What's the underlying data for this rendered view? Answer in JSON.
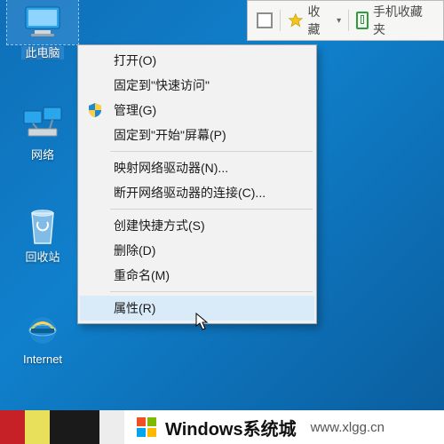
{
  "desktop_icons": {
    "this_pc": "此电脑",
    "network": "网络",
    "recycle": "回收站",
    "ie": "Internet"
  },
  "toolbar": {
    "favorites_label": "收藏",
    "mobile_fav_label": "手机收藏夹"
  },
  "ctx": {
    "open": "打开(O)",
    "pin_quick": "固定到\"快速访问\"",
    "manage": "管理(G)",
    "pin_start": "固定到\"开始\"屏幕(P)",
    "map_drive": "映射网络驱动器(N)...",
    "disconnect_drive": "断开网络驱动器的连接(C)...",
    "create_shortcut": "创建快捷方式(S)",
    "delete": "删除(D)",
    "rename": "重命名(M)",
    "properties": "属性(R)"
  },
  "watermark": {
    "bar_colors": [
      "#c62127",
      "#e8e05a",
      "#1a1a1a",
      "#1a1a1a",
      "#ededed"
    ],
    "title": "Windows系统城",
    "url": "www.xlgg.cn"
  }
}
